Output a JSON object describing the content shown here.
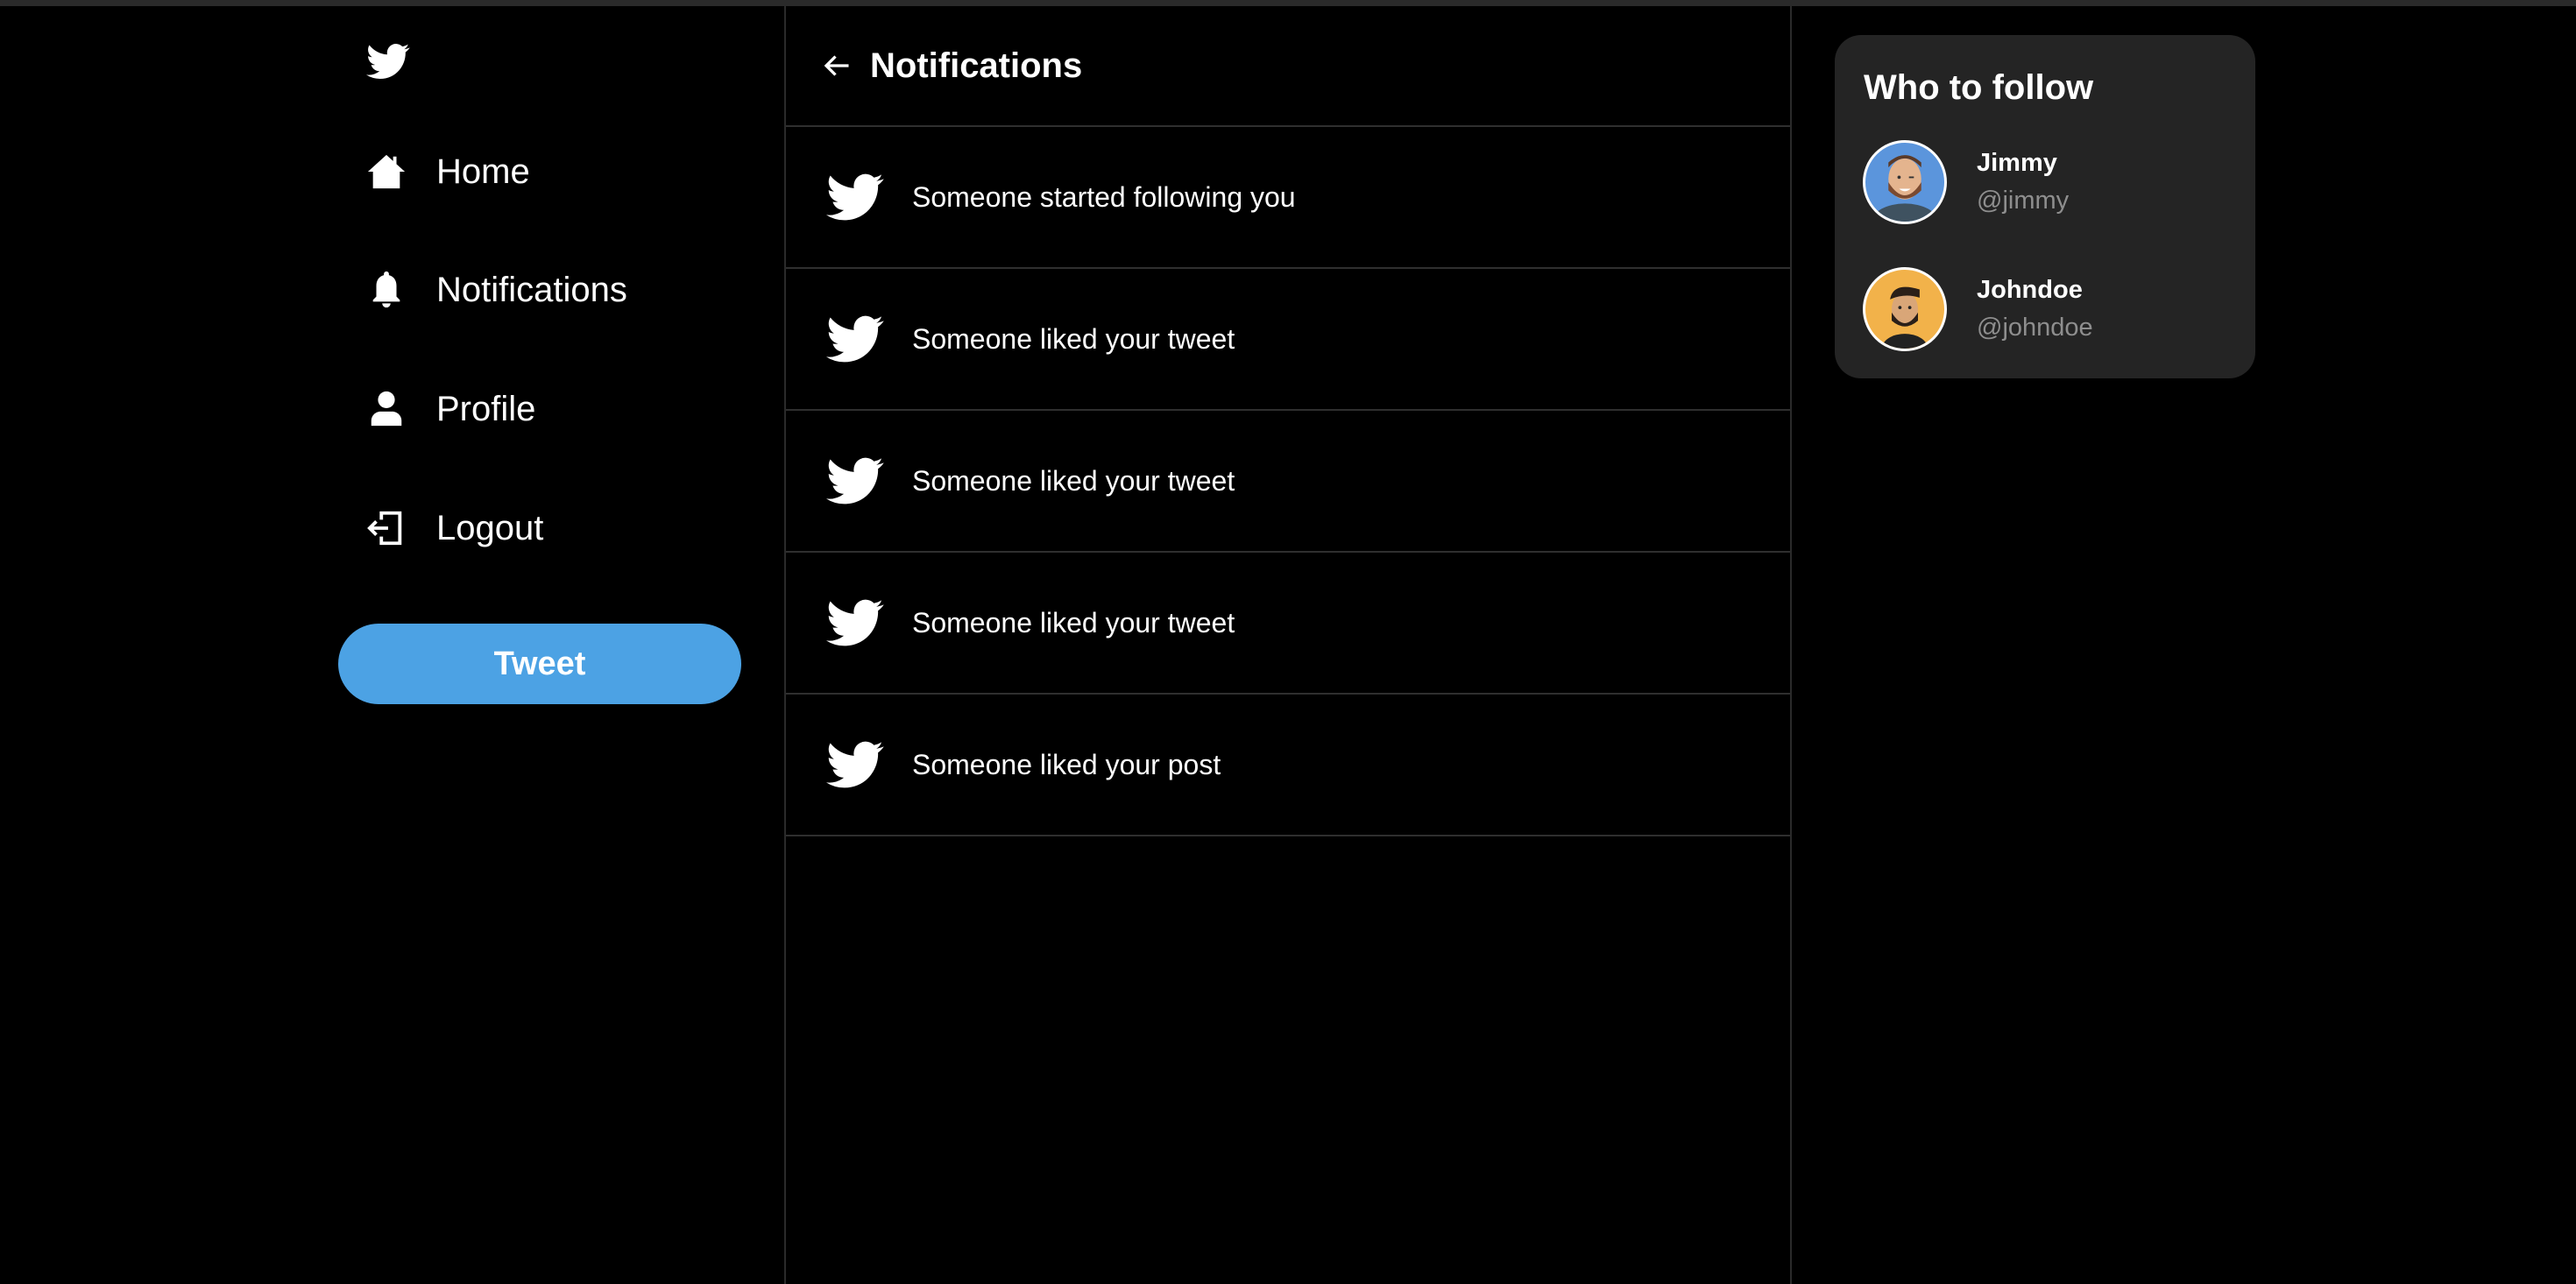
{
  "sidebar": {
    "items": [
      {
        "label": "Home",
        "icon": "home-icon"
      },
      {
        "label": "Notifications",
        "icon": "bell-icon"
      },
      {
        "label": "Profile",
        "icon": "user-icon"
      },
      {
        "label": "Logout",
        "icon": "logout-icon"
      }
    ],
    "tweet_label": "Tweet"
  },
  "main": {
    "title": "Notifications",
    "notifications": [
      {
        "text": "Someone started following you"
      },
      {
        "text": "Someone liked your tweet"
      },
      {
        "text": "Someone liked your tweet"
      },
      {
        "text": "Someone liked your tweet"
      },
      {
        "text": "Someone liked your post"
      }
    ]
  },
  "who_to_follow": {
    "title": "Who to follow",
    "users": [
      {
        "name": "Jimmy",
        "handle": "@jimmy",
        "avatar_color": "#5b95dc"
      },
      {
        "name": "Johndoe",
        "handle": "@johndoe",
        "avatar_color": "#f2b24a"
      }
    ]
  },
  "colors": {
    "accent": "#4ca2e4",
    "card": "#242424"
  }
}
